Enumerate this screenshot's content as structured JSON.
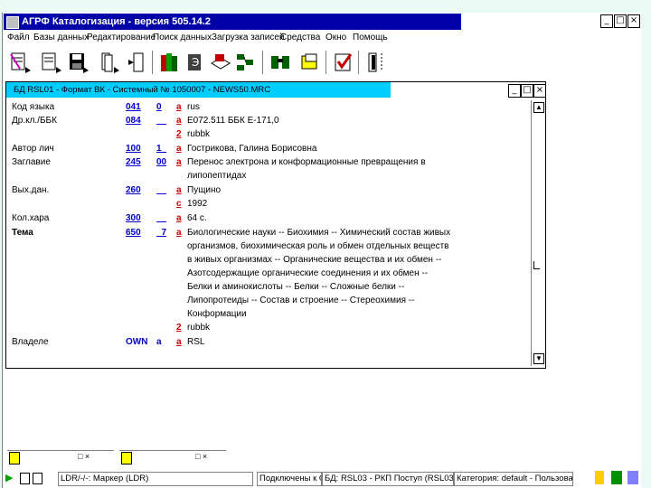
{
  "window": {
    "title": "АГРФ Каталогизация - версия 505.14.2",
    "min": "_",
    "max": "□",
    "close": "×"
  },
  "menu": [
    "Файл",
    "Базы данных",
    "Редактирование",
    "Поиск данных",
    "Загрузка записей",
    "Средства",
    "Окно",
    "Помощь"
  ],
  "toolbar": {
    "icons": [
      "new-record-icon",
      "save-record-icon",
      "save-icon",
      "copy-record-icon",
      "delete-record-icon",
      "books-icon",
      "dictionary-icon",
      "print-icon",
      "tree-icon",
      "binoculars-icon",
      "basket-icon",
      "check-icon",
      "exit-icon"
    ]
  },
  "doc": {
    "title": "БД RSL01 - Формат ВК - Системный № 1050007 - NEWS50.MRC",
    "min": "_",
    "max": "□",
    "close": "×",
    "rows": [
      {
        "label": "Код языка",
        "tag": "041",
        "ind": "0",
        "sub": "a",
        "val": "rus"
      },
      {
        "label": "Др.кл./ББК",
        "tag": "084",
        "ind": "__",
        "sub": "a",
        "val": "Е072.511 ББК Е-171,0"
      },
      {
        "label": "",
        "tag": "",
        "ind": "",
        "sub": "2",
        "val": "rubbk"
      },
      {
        "label": "Автор лич",
        "tag": "100",
        "ind": "1_",
        "sub": "a",
        "val": "Гострикова, Галина Борисовна"
      },
      {
        "label": "Заглавие",
        "tag": "245",
        "ind": "00",
        "sub": "a",
        "val": "Перенос электрона и конформационные превращения в"
      },
      {
        "label": "",
        "tag": "",
        "ind": "",
        "sub": "",
        "val": "липопептидах"
      },
      {
        "label": "Вых.дан.",
        "tag": "260",
        "ind": "__",
        "sub": "a",
        "val": "Пущино"
      },
      {
        "label": "",
        "tag": "",
        "ind": "",
        "sub": "c",
        "val": "1992"
      },
      {
        "label": "Кол.хара",
        "tag": "300",
        "ind": "__",
        "sub": "a",
        "val": "64 с."
      },
      {
        "label": "Тема",
        "tag": "650",
        "ind": "_7",
        "sub": "a",
        "val": "Биологические науки -- Биохимия -- Химический состав живых"
      },
      {
        "label": "",
        "tag": "",
        "ind": "",
        "sub": "",
        "val": "организмов, биохимическая роль и обмен отдельных веществ"
      },
      {
        "label": "",
        "tag": "",
        "ind": "",
        "sub": "",
        "val": "в живых организмах -- Органические вещества и их обмен --"
      },
      {
        "label": "",
        "tag": "",
        "ind": "",
        "sub": "",
        "val": "Азотсодержащие органические соединения и их обмен --"
      },
      {
        "label": "",
        "tag": "",
        "ind": "",
        "sub": "",
        "val": "Белки и аминокислоты -- Белки -- Сложные белки --"
      },
      {
        "label": "",
        "tag": "",
        "ind": "",
        "sub": "",
        "val": "Липопротеиды -- Состав и строение -- Стереохимия --"
      },
      {
        "label": "",
        "tag": "",
        "ind": "",
        "sub": "",
        "val": "Конформации"
      },
      {
        "label": "",
        "tag": "",
        "ind": "",
        "sub": "2",
        "val": "rubbk"
      },
      {
        "label": "Владеле",
        "tag": "OWN",
        "ind": "a",
        "sub": "a",
        "val": "RSL"
      }
    ]
  },
  "minimized": {
    "left_btns": "□ ×",
    "right_btns": "□ ×"
  },
  "status": {
    "start_icon": "▶",
    "cells": [
      "LDR/-/-: Маркер (LDR)",
      "Подключены к О",
      "БД: RSL03 - РКП Поступ (RSL03)",
      "Категория: default - Пользователь"
    ]
  }
}
